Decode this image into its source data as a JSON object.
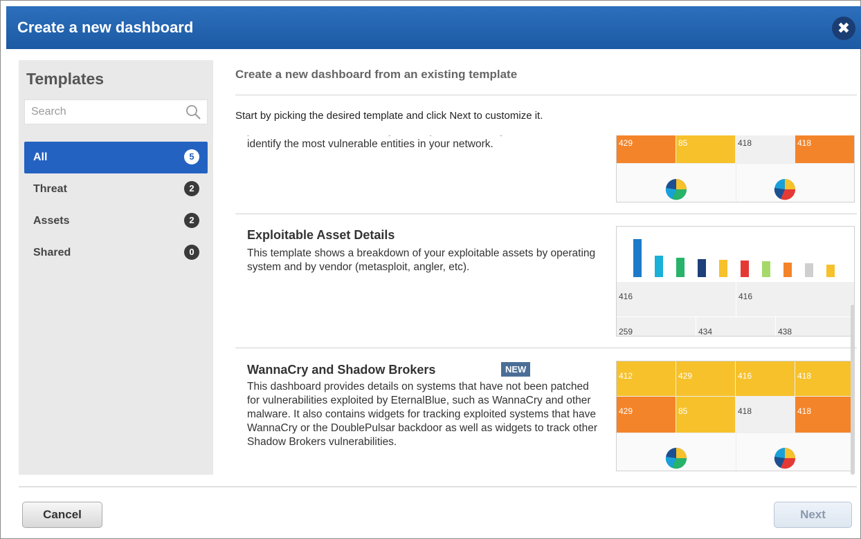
{
  "dialog": {
    "title": "Create a new dashboard",
    "close_glyph": "✖"
  },
  "sidebar": {
    "title": "Templates",
    "search_placeholder": "Search",
    "items": [
      {
        "label": "All",
        "count": "5"
      },
      {
        "label": "Threat",
        "count": "2"
      },
      {
        "label": "Assets",
        "count": "2"
      },
      {
        "label": "Shared",
        "count": "0"
      }
    ]
  },
  "main": {
    "heading": "Create a new dashboard from an existing template",
    "instructions": "Start by picking the desired template and click Next to customize it.",
    "templates": [
      {
        "title": "",
        "description": "your indexed assets. It leverages Qualys threat intelligence data flow to identify the most vulnerable entities in your network.",
        "thumb_numbers": [
          "429",
          "85",
          "418",
          "418"
        ]
      },
      {
        "title": "Exploitable Asset Details",
        "description": "This template shows a breakdown of your exploitable assets by operating system and by vendor (metasploit, angler, etc).",
        "thumb_numbers": [
          "416",
          "416",
          "259",
          "434",
          "438"
        ]
      },
      {
        "title": "WannaCry and Shadow Brokers",
        "badge": "NEW",
        "description": "This dashboard provides details on systems that have not been patched for vulnerabilities exploited by EternalBlue, such as WannaCry and other malware. It also contains widgets for tracking exploited systems that have WannaCry or the DoublePulsar backdoor as well as widgets to track other Shadow Brokers vulnerabilities.",
        "thumb_numbers": [
          "412",
          "429",
          "416",
          "418",
          "429",
          "85",
          "418",
          "418"
        ]
      }
    ]
  },
  "footer": {
    "cancel_label": "Cancel",
    "next_label": "Next"
  },
  "colors": {
    "title_bar": "#2166b5",
    "active_item": "#2462c2",
    "orange": "#f4842a",
    "yellow": "#f6c12b"
  }
}
